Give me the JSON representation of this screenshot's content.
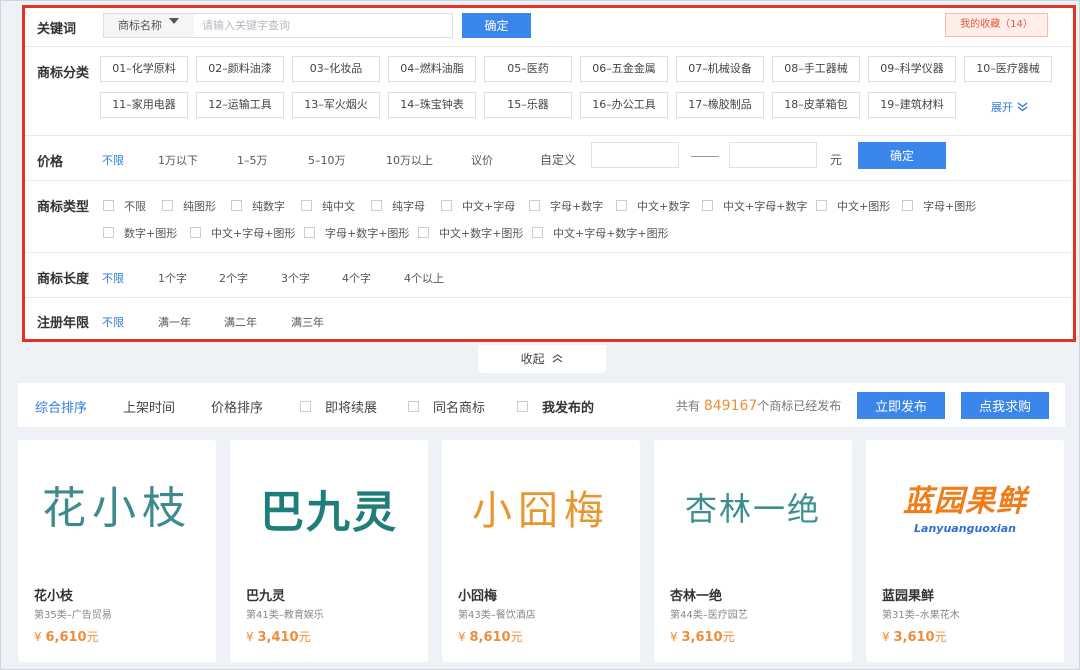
{
  "filters": {
    "keyword": {
      "label": "关键词",
      "select_value": "商标名称",
      "placeholder": "请输入关键字查询",
      "confirm": "确定",
      "favorites": "我的收藏（14）"
    },
    "category": {
      "label": "商标分类",
      "items": [
        "01–化学原料",
        "02–颜料油漆",
        "03–化妆品",
        "04–燃料油脂",
        "05–医药",
        "06–五金金属",
        "07–机械设备",
        "08–手工器械",
        "09–科学仪器",
        "10–医疗器械",
        "11–家用电器",
        "12–运输工具",
        "13–军火烟火",
        "14–珠宝钟表",
        "15–乐器",
        "16–办公工具",
        "17–橡胶制品",
        "18–皮革箱包",
        "19–建筑材料"
      ],
      "expand": "展开"
    },
    "price": {
      "label": "价格",
      "options": [
        "不限",
        "1万以下",
        "1–5万",
        "5–10万",
        "10万以上",
        "议价"
      ],
      "custom_label": "自定义",
      "unit": "元",
      "confirm": "确定"
    },
    "type": {
      "label": "商标类型",
      "options": [
        "不限",
        "纯图形",
        "纯数字",
        "纯中文",
        "纯字母",
        "中文+字母",
        "字母+数字",
        "中文+数字",
        "中文+字母+数字",
        "中文+图形",
        "字母+图形",
        "数字+图形",
        "中文+字母+图形",
        "字母+数字+图形",
        "中文+数字+图形",
        "中文+字母+数字+图形"
      ]
    },
    "length": {
      "label": "商标长度",
      "options": [
        "不限",
        "1个字",
        "2个字",
        "3个字",
        "4个字",
        "4个以上"
      ]
    },
    "years": {
      "label": "注册年限",
      "options": [
        "不限",
        "满一年",
        "满二年",
        "满三年"
      ]
    }
  },
  "collapse": "收起",
  "sort": {
    "items": [
      "综合排序",
      "上架时间",
      "价格排序"
    ],
    "checks": [
      "即将续展",
      "同名商标",
      "我发布的"
    ],
    "total_prefix": "共有",
    "total_count": "849167",
    "total_suffix": "个商标已经发布",
    "publish": "立即发布",
    "request": "点我求购"
  },
  "cards": [
    {
      "logo": "花小枝",
      "name": "花小枝",
      "category": "第35类–广告贸易",
      "price_symbol": "¥",
      "price": "6,610",
      "price_unit": "元",
      "logo_color": "#3f8a8c"
    },
    {
      "logo": "巴九灵",
      "name": "巴九灵",
      "category": "第41类–教育娱乐",
      "price_symbol": "¥",
      "price": "3,410",
      "price_unit": "元",
      "logo_color": "#1f7d7a"
    },
    {
      "logo": "小囧梅",
      "name": "小囧梅",
      "category": "第43类–餐饮酒店",
      "price_symbol": "¥",
      "price": "8,610",
      "price_unit": "元",
      "logo_color": "#e8962e"
    },
    {
      "logo": "杏林一绝",
      "name": "杏林一绝",
      "category": "第44类–医疗园艺",
      "price_symbol": "¥",
      "price": "3,610",
      "price_unit": "元",
      "logo_color": "#3b8f8f"
    },
    {
      "logo": "蓝园果鲜",
      "logo_sub": "Lanyuanguoxian",
      "name": "蓝园果鲜",
      "category": "第31类–水果花木",
      "price_symbol": "¥",
      "price": "3,610",
      "price_unit": "元",
      "logo_color": "#f07d1a",
      "logo_sub_color": "#2f6fd6"
    }
  ]
}
